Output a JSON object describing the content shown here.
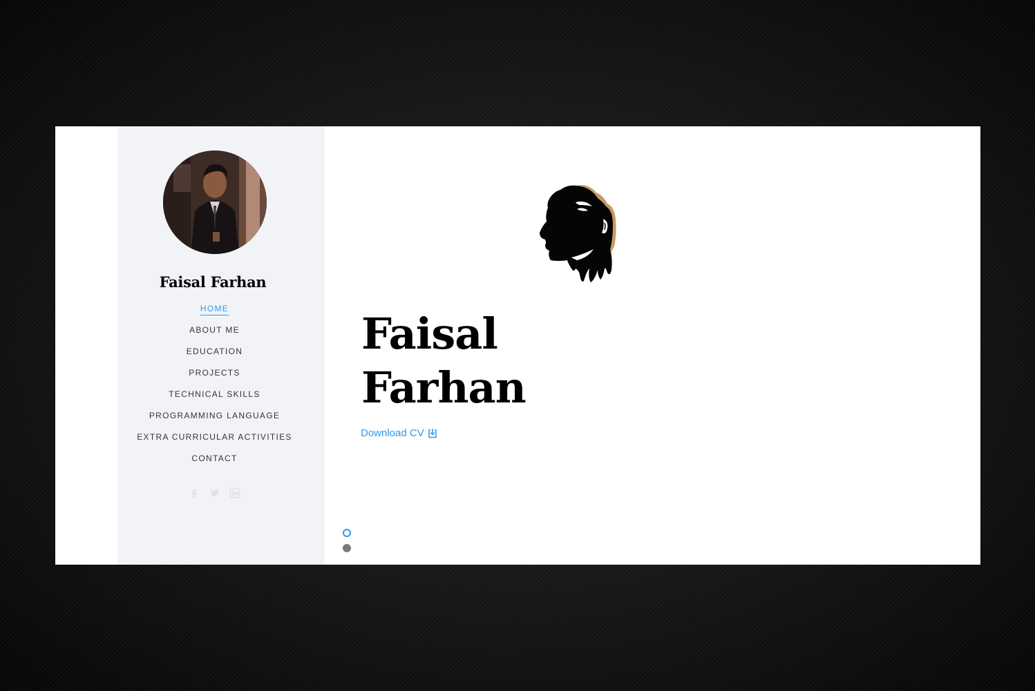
{
  "sidebar": {
    "name": "Faisal Farhan",
    "nav": [
      {
        "label": "HOME",
        "active": true
      },
      {
        "label": "ABOUT ME",
        "active": false
      },
      {
        "label": "EDUCATION",
        "active": false
      },
      {
        "label": "PROJECTS",
        "active": false
      },
      {
        "label": "TECHNICAL SKILLS",
        "active": false
      },
      {
        "label": "PROGRAMMING LANGUAGE",
        "active": false
      },
      {
        "label": "EXTRA CURRICULAR ACTIVITIES",
        "active": false
      },
      {
        "label": "CONTACT",
        "active": false
      }
    ],
    "social_icons": [
      "facebook-icon",
      "twitter-icon",
      "linkedin-icon"
    ]
  },
  "hero": {
    "title_line1": "Faisal",
    "title_line2": "Farhan",
    "cv_label": "Download CV",
    "cv_icon": "download-icon"
  },
  "slider": {
    "slides": 2,
    "active_index": 0
  },
  "colors": {
    "accent": "#2c98f0",
    "sidebar_bg": "#f2f3f7",
    "inactive_dot": "#7a7a7a"
  }
}
